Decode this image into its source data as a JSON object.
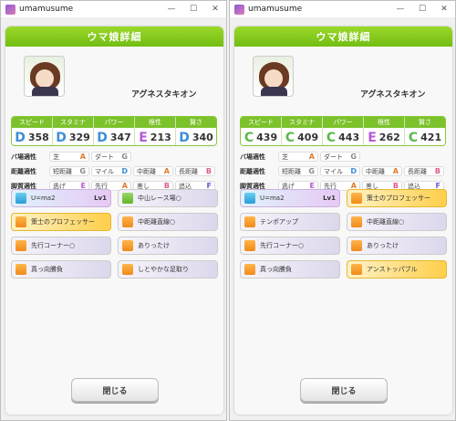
{
  "windows": [
    {
      "title": "umamusume",
      "header": "ウマ娘詳細",
      "name": "アグネスタキオン",
      "stat_labels": [
        "スピード",
        "スタミナ",
        "パワー",
        "根性",
        "賢さ"
      ],
      "stats": [
        {
          "grade": "D",
          "value": "358",
          "color": "#3c8ed6"
        },
        {
          "grade": "D",
          "value": "329",
          "color": "#3c8ed6"
        },
        {
          "grade": "D",
          "value": "347",
          "color": "#3c8ed6"
        },
        {
          "grade": "E",
          "value": "213",
          "color": "#b55ad6"
        },
        {
          "grade": "D",
          "value": "340",
          "color": "#3c8ed6"
        }
      ],
      "aptitude": {
        "track_label": "バ場適性",
        "track": [
          {
            "n": "芝",
            "g": "A"
          },
          {
            "n": "ダート",
            "g": "G"
          }
        ],
        "distance_label": "距離適性",
        "distance": [
          {
            "n": "短距離",
            "g": "G"
          },
          {
            "n": "マイル",
            "g": "D"
          },
          {
            "n": "中距離",
            "g": "A"
          },
          {
            "n": "長距離",
            "g": "B"
          }
        ],
        "style_label": "脚質適性",
        "style": [
          {
            "n": "逃げ",
            "g": "E"
          },
          {
            "n": "先行",
            "g": "A"
          },
          {
            "n": "差し",
            "g": "B"
          },
          {
            "n": "追込",
            "g": "F"
          }
        ]
      },
      "skills": [
        {
          "name": "U=ma2",
          "lv": "Lv1",
          "type": "unique",
          "icon": "ic-blue"
        },
        {
          "name": "中山レース場○",
          "lv": "",
          "type": "normal",
          "icon": "ic-green"
        },
        {
          "name": "策士のプロフェッサー",
          "lv": "",
          "type": "gold",
          "icon": "ic-orange"
        },
        {
          "name": "中距離直線○",
          "lv": "",
          "type": "normal",
          "icon": "ic-orange"
        },
        {
          "name": "先行コーナー○",
          "lv": "",
          "type": "normal",
          "icon": "ic-orange"
        },
        {
          "name": "ありったけ",
          "lv": "",
          "type": "normal",
          "icon": "ic-orange"
        },
        {
          "name": "真っ向勝負",
          "lv": "",
          "type": "normal",
          "icon": "ic-orange"
        },
        {
          "name": "しとやかな足取り",
          "lv": "",
          "type": "normal",
          "icon": "ic-orange"
        }
      ],
      "close_label": "閉じる"
    },
    {
      "title": "umamusume",
      "header": "ウマ娘詳細",
      "name": "アグネスタキオン",
      "stat_labels": [
        "スピード",
        "スタミナ",
        "パワー",
        "根性",
        "賢さ"
      ],
      "stats": [
        {
          "grade": "C",
          "value": "439",
          "color": "#5cb84a"
        },
        {
          "grade": "C",
          "value": "409",
          "color": "#5cb84a"
        },
        {
          "grade": "C",
          "value": "443",
          "color": "#5cb84a"
        },
        {
          "grade": "E",
          "value": "262",
          "color": "#b55ad6"
        },
        {
          "grade": "C",
          "value": "421",
          "color": "#5cb84a"
        }
      ],
      "aptitude": {
        "track_label": "バ場適性",
        "track": [
          {
            "n": "芝",
            "g": "A"
          },
          {
            "n": "ダート",
            "g": "G"
          }
        ],
        "distance_label": "距離適性",
        "distance": [
          {
            "n": "短距離",
            "g": "G"
          },
          {
            "n": "マイル",
            "g": "D"
          },
          {
            "n": "中距離",
            "g": "A"
          },
          {
            "n": "長距離",
            "g": "B"
          }
        ],
        "style_label": "脚質適性",
        "style": [
          {
            "n": "逃げ",
            "g": "E"
          },
          {
            "n": "先行",
            "g": "A"
          },
          {
            "n": "差し",
            "g": "B"
          },
          {
            "n": "追込",
            "g": "F"
          }
        ]
      },
      "skills": [
        {
          "name": "U=ma2",
          "lv": "Lv1",
          "type": "unique",
          "icon": "ic-blue"
        },
        {
          "name": "策士のプロフェッサー",
          "lv": "",
          "type": "gold",
          "icon": "ic-orange"
        },
        {
          "name": "テンポアップ",
          "lv": "",
          "type": "normal",
          "icon": "ic-orange"
        },
        {
          "name": "中距離直線○",
          "lv": "",
          "type": "normal",
          "icon": "ic-orange"
        },
        {
          "name": "先行コーナー○",
          "lv": "",
          "type": "normal",
          "icon": "ic-orange"
        },
        {
          "name": "ありったけ",
          "lv": "",
          "type": "normal",
          "icon": "ic-orange"
        },
        {
          "name": "真っ向勝負",
          "lv": "",
          "type": "normal",
          "icon": "ic-orange"
        },
        {
          "name": "アンストッパブル",
          "lv": "",
          "type": "gold",
          "icon": "ic-orange"
        }
      ],
      "close_label": "閉じる"
    }
  ],
  "window_controls": [
    "—",
    "☐",
    "✕"
  ]
}
